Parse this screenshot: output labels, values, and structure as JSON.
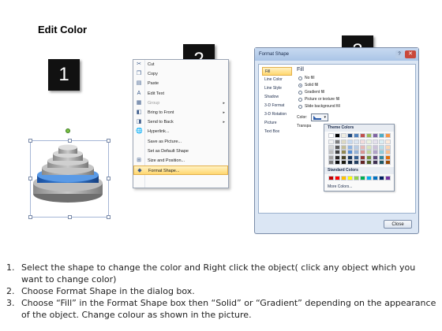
{
  "title": "Edit Color",
  "steps": [
    "1",
    "2",
    "3"
  ],
  "context_menu": {
    "items": [
      {
        "label": "Cut",
        "icon": "scissors-icon",
        "glyph": "✂",
        "disabled": false,
        "submenu": false
      },
      {
        "label": "Copy",
        "icon": "copy-icon",
        "glyph": "❐",
        "disabled": false,
        "submenu": false
      },
      {
        "label": "Paste",
        "icon": "paste-icon",
        "glyph": "▤",
        "disabled": false,
        "submenu": false
      },
      {
        "label": "Edit Text",
        "icon": "edit-text-icon",
        "glyph": "A",
        "disabled": false,
        "submenu": false
      },
      {
        "label": "Group",
        "icon": "group-icon",
        "glyph": "▦",
        "disabled": true,
        "submenu": true
      },
      {
        "label": "Bring to Front",
        "icon": "bring-front-icon",
        "glyph": "◧",
        "disabled": false,
        "submenu": true
      },
      {
        "label": "Send to Back",
        "icon": "send-back-icon",
        "glyph": "◨",
        "disabled": false,
        "submenu": true
      },
      {
        "label": "Hyperlink...",
        "icon": "hyperlink-icon",
        "glyph": "🌐",
        "disabled": false,
        "submenu": false
      },
      {
        "label": "Save as Picture...",
        "icon": "",
        "glyph": "",
        "disabled": false,
        "submenu": false
      },
      {
        "label": "Set as Default Shape",
        "icon": "",
        "glyph": "",
        "disabled": false,
        "submenu": false
      },
      {
        "label": "Size and Position...",
        "icon": "size-position-icon",
        "glyph": "⊞",
        "disabled": false,
        "submenu": false
      },
      {
        "label": "Format Shape...",
        "icon": "format-shape-icon",
        "glyph": "◆",
        "disabled": false,
        "submenu": false,
        "highlight": true
      }
    ]
  },
  "dialog": {
    "title": "Format Shape",
    "nav": [
      "Fill",
      "Line Color",
      "Line Style",
      "Shadow",
      "3-D Format",
      "3-D Rotation",
      "Picture",
      "Text Box"
    ],
    "active_nav": "Fill",
    "heading": "Fill",
    "options": [
      {
        "label": "No fill",
        "selected": false
      },
      {
        "label": "Solid fill",
        "selected": true
      },
      {
        "label": "Gradient fill",
        "selected": false
      },
      {
        "label": "Picture or texture fill",
        "selected": false
      },
      {
        "label": "Slide background fill",
        "selected": false
      }
    ],
    "color_label": "Color:",
    "transparency_label": "Transpa",
    "close_label": "Close"
  },
  "color_popup": {
    "theme_heading": "Theme Colors",
    "standard_heading": "Standard Colors",
    "more": "More Colors...",
    "theme_base": [
      "#ffffff",
      "#000000",
      "#eeece1",
      "#1f497d",
      "#4f81bd",
      "#c0504d",
      "#9bbb59",
      "#8064a2",
      "#4bacc6",
      "#f79646"
    ],
    "theme_shades": [
      [
        "#f2f2f2",
        "#7f7f7f",
        "#ddd9c3",
        "#c6d9f0",
        "#dbe5f1",
        "#f2dcdb",
        "#ebf1dd",
        "#e5e0ec",
        "#dbeef3",
        "#fdeada"
      ],
      [
        "#d8d8d8",
        "#595959",
        "#c4bd97",
        "#8db3e2",
        "#b8cce4",
        "#e5b9b7",
        "#d7e3bc",
        "#ccc1d9",
        "#b7dde8",
        "#fbd5b5"
      ],
      [
        "#bfbfbf",
        "#3f3f3f",
        "#938953",
        "#548dd4",
        "#95b3d7",
        "#d99694",
        "#c3d69b",
        "#b2a2c7",
        "#92cddc",
        "#fac08f"
      ],
      [
        "#a5a5a5",
        "#262626",
        "#494429",
        "#17365d",
        "#366092",
        "#953734",
        "#76923c",
        "#5f497a",
        "#31859b",
        "#e36c09"
      ],
      [
        "#7f7f7f",
        "#0c0c0c",
        "#1d1b10",
        "#0f243e",
        "#244061",
        "#632423",
        "#4f6128",
        "#3f3151",
        "#205867",
        "#974806"
      ]
    ],
    "standard": [
      "#c00000",
      "#ff0000",
      "#ffc000",
      "#ffff00",
      "#92d050",
      "#00b050",
      "#00b0f0",
      "#0070c0",
      "#002060",
      "#7030a0"
    ]
  },
  "instructions": [
    {
      "num": "1.",
      "text": "Select the shape to change the color and Right click the object( click any object which you want to change color)"
    },
    {
      "num": "2.",
      "text": "Choose Format Shape in the dialog box."
    },
    {
      "num": "3.",
      "text": "Choose “Fill” in the Format Shape box then “Solid” or “Gradient” depending on the appearance of the object. Change colour as shown in the picture."
    }
  ],
  "colors": {
    "accent_blue": "#1f6fd0",
    "badge_bg": "#111111",
    "menu_highlight": "#ffd66e"
  }
}
